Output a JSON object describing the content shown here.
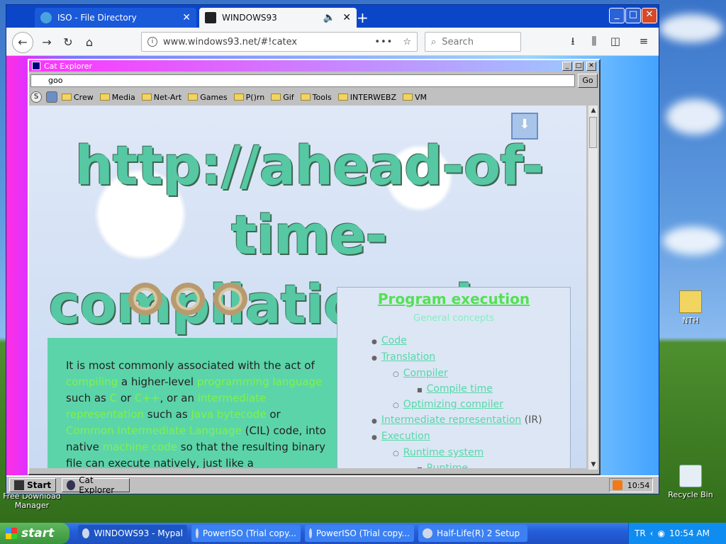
{
  "browser": {
    "tabs": [
      {
        "title": "ISO - File Directory",
        "active": false
      },
      {
        "title": "WINDOWS93",
        "active": true
      }
    ],
    "url": "www.windows93.net/#!catex",
    "search_placeholder": "Search"
  },
  "cat_explorer": {
    "title": "Cat Explorer",
    "address_value": "goo",
    "go_label": "Go",
    "bookmarks": [
      "Crew",
      "Media",
      "Net-Art",
      "Games",
      "P()rn",
      "Gif",
      "Tools",
      "INTERWEBZ",
      "VM"
    ],
    "page": {
      "heading": "http://ahead-of-time-compilation.pizza",
      "paragraph_parts": [
        "It is most commonly associated with the act of ",
        "compiling",
        " a higher-level ",
        "programming language",
        " such as ",
        "C",
        " or ",
        "C++",
        ", or an ",
        "intermediate representation",
        " such as ",
        "Java bytecode",
        " or ",
        "Common Intermediate Language",
        " (CIL) code, into native ",
        "machine code",
        " so that the resulting binary file can execute natively, just like a"
      ],
      "sidebox": {
        "title": "Program execution",
        "subtitle": "General concepts",
        "items": [
          {
            "level": 1,
            "text": "Code"
          },
          {
            "level": 1,
            "text": "Translation"
          },
          {
            "level": 2,
            "text": "Compiler"
          },
          {
            "level": 3,
            "text": "Compile time"
          },
          {
            "level": 2,
            "text": "Optimizing compiler"
          },
          {
            "level": 1,
            "text": "Intermediate representation",
            "suffix": " (IR)"
          },
          {
            "level": 1,
            "text": "Execution"
          },
          {
            "level": 2,
            "text": "Runtime system"
          },
          {
            "level": 3,
            "text": "Runtime"
          }
        ]
      }
    }
  },
  "w93_taskbar": {
    "start_label": "Start",
    "task_label": "Cat Explorer",
    "clock": "10:54"
  },
  "xp_desktop": {
    "icons": [
      {
        "label": "NTH"
      },
      {
        "label": "Recycle Bin"
      },
      {
        "label": "Free Download Manager"
      }
    ]
  },
  "xp_taskbar": {
    "start_label": "start",
    "tasks": [
      "WINDOWS93 - Mypal",
      "PowerISO (Trial copy...",
      "PowerISO (Trial copy...",
      "Half-Life(R) 2 Setup"
    ],
    "lang": "TR",
    "clock": "10:54 AM"
  }
}
